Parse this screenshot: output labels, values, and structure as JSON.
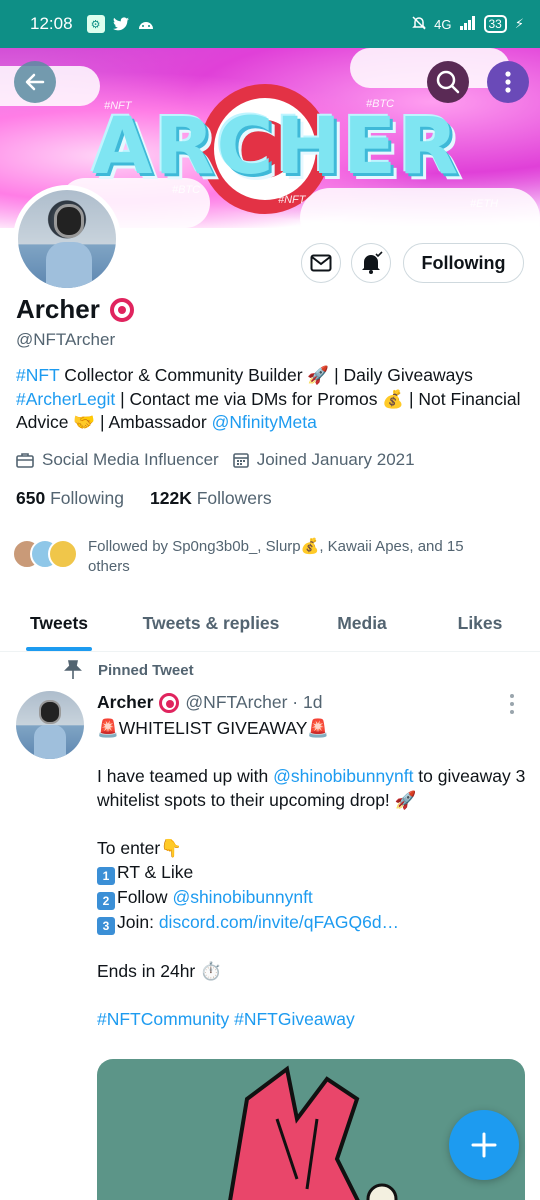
{
  "status_bar": {
    "time": "12:08",
    "battery": "33",
    "network": "4G"
  },
  "profile": {
    "name": "Archer",
    "handle": "@NFTArcher",
    "bio": {
      "part1_tag": "#NFT",
      "part1_text": " Collector & Community Builder 🚀 | Daily Giveaways ",
      "part2_tag": "#ArcherLegit",
      "part2_text": " | Contact me via DMs for Promos 💰 | Not Financial Advice 🤝 | Ambassador ",
      "mention": "@NfinityMeta"
    },
    "category": "Social Media Influencer",
    "joined": "Joined January 2021",
    "following_count": "650",
    "following_label": "Following",
    "followers_count": "122K",
    "followers_label": "Followers",
    "followed_by": "Followed by Sp0ng3b0b_, Slurp💰, Kawaii Apes, and 15 others",
    "follow_button": "Following"
  },
  "banner": {
    "title": "ARCHER",
    "tags": [
      "#NFT",
      "#BTC",
      "#BTC",
      "#NFT",
      "#ETH"
    ]
  },
  "tabs": [
    {
      "label": "Tweets",
      "active": true
    },
    {
      "label": "Tweets & replies",
      "active": false
    },
    {
      "label": "Media",
      "active": false
    },
    {
      "label": "Likes",
      "active": false
    }
  ],
  "tweet": {
    "pinned_label": "Pinned Tweet",
    "author": "Archer",
    "handle_time": "@NFTArcher · 1d",
    "line_title": "🚨WHITELIST GIVEAWAY🚨",
    "line_intro_1": "I have teamed up with ",
    "line_intro_mention": "@shinobibunnynft",
    "line_intro_2": " to giveaway 3 whitelist spots to their upcoming drop! 🚀",
    "line_enter": "To enter👇",
    "step1": "RT & Like",
    "step2_text": "Follow ",
    "step2_mention": "@shinobibunnynft",
    "step3_text": "Join: ",
    "step3_link": "discord.com/invite/qFAGQ6d…",
    "line_ends": "Ends in 24hr ⏱️",
    "hashtags": "#NFTCommunity #NFTGiveaway",
    "keycaps": [
      "1",
      "2",
      "3"
    ]
  },
  "colors": {
    "accent": "#1d9bf0",
    "status_bar": "#0e8f86",
    "text_primary": "#0f1419",
    "text_secondary": "#536471"
  },
  "icons": {
    "back": "arrow-left-icon",
    "search": "search-icon",
    "more": "more-vertical-icon",
    "message": "envelope-icon",
    "notifications": "bell-icon",
    "category": "briefcase-icon",
    "joined": "calendar-icon",
    "pin": "pin-icon",
    "compose": "plus-icon"
  }
}
